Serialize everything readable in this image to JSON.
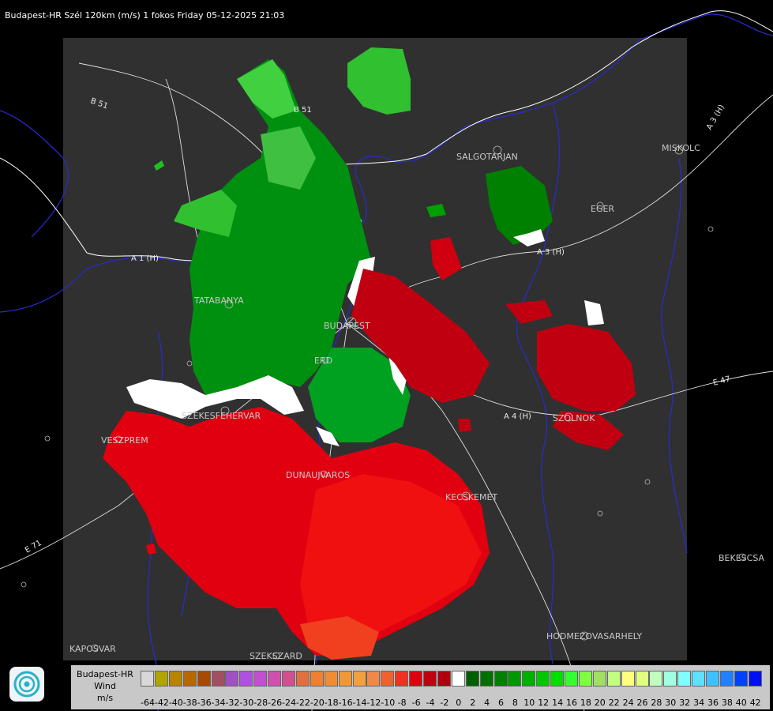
{
  "header": {
    "title": "Budapest-HR Szél 120km (m/s) 1 fokos Friday 05-12-2025 21:03"
  },
  "cities": [
    {
      "name": "SALGOTARJAN"
    },
    {
      "name": "MISKOLC"
    },
    {
      "name": "EGER"
    },
    {
      "name": "TATABANYA"
    },
    {
      "name": "BUDAPEST"
    },
    {
      "name": "ERD"
    },
    {
      "name": "SZEKESFEHERVAR"
    },
    {
      "name": "VESZPREM"
    },
    {
      "name": "DUNAUJVAROS"
    },
    {
      "name": "KECSKEMET"
    },
    {
      "name": "SZOLNOK"
    },
    {
      "name": "BEKESCSA"
    },
    {
      "name": "HODMEZOVASARHELY"
    },
    {
      "name": "KAPOSVAR"
    },
    {
      "name": "SZEKSZARD"
    }
  ],
  "roads": [
    {
      "name": "B 51"
    },
    {
      "name": "A 1 (H)"
    },
    {
      "name": "A 3 (H)"
    },
    {
      "name": "A 3 (H)"
    },
    {
      "name": "A 4 (H)"
    },
    {
      "name": "E 47"
    },
    {
      "name": "E 71"
    },
    {
      "name": "B 51"
    }
  ],
  "legend": {
    "station": "Budapest-HR",
    "quantity": "Wind",
    "unit": "m/s",
    "ticks": [
      "-64",
      "-42",
      "-40",
      "-38",
      "-36",
      "-34",
      "-32",
      "-30",
      "-28",
      "-26",
      "-24",
      "-22",
      "-20",
      "-18",
      "-16",
      "-14",
      "-12",
      "-10",
      "-8",
      "-6",
      "-4",
      "-2",
      "0",
      "2",
      "4",
      "6",
      "8",
      "10",
      "12",
      "14",
      "16",
      "18",
      "20",
      "22",
      "24",
      "26",
      "28",
      "30",
      "32",
      "34",
      "36",
      "38",
      "40",
      "42"
    ],
    "colors": [
      "#d8d8d8",
      "#b0a400",
      "#b88400",
      "#b86800",
      "#a84a00",
      "#a05060",
      "#a050c0",
      "#b050e0",
      "#c050d0",
      "#d050b0",
      "#d05090",
      "#e07040",
      "#f08030",
      "#f08c34",
      "#f09838",
      "#f0a040",
      "#f08848",
      "#f06030",
      "#f03020",
      "#e00010",
      "#c00010",
      "#b00010",
      "#ffffff",
      "#006000",
      "#007000",
      "#008000",
      "#009800",
      "#00b000",
      "#00c800",
      "#00e000",
      "#30ff30",
      "#80ff40",
      "#a0e060",
      "#c0ff80",
      "#ffff80",
      "#e0ff80",
      "#c0ffc0",
      "#a0ffe0",
      "#80ffff",
      "#60e0ff",
      "#40c0ff",
      "#2080ff",
      "#0040ff",
      "#0010f0"
    ]
  }
}
